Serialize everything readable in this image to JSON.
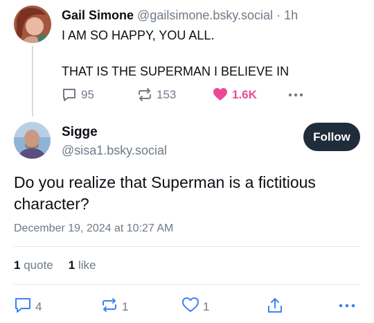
{
  "parent_post": {
    "display_name": "Gail Simone",
    "handle": "@gailsimone.bsky.social",
    "separator": "·",
    "time": "1h",
    "line1": "I AM SO HAPPY, YOU ALL.",
    "line2": "THAT IS THE SUPERMAN I BELIEVE IN",
    "replies": "95",
    "reposts": "153",
    "likes": "1.6K",
    "like_color": "#ec4899"
  },
  "main_post": {
    "display_name": "Sigge",
    "handle": "@sisa1.bsky.social",
    "follow_label": "Follow",
    "text": "Do you realize that Superman is a fictitious character?",
    "date": "December 19, 2024 at 10:27 AM",
    "quotes_count": "1",
    "quotes_label": "quote",
    "likes_count": "1",
    "likes_label": "like",
    "replies": "4",
    "reposts": "1",
    "likes": "1"
  }
}
